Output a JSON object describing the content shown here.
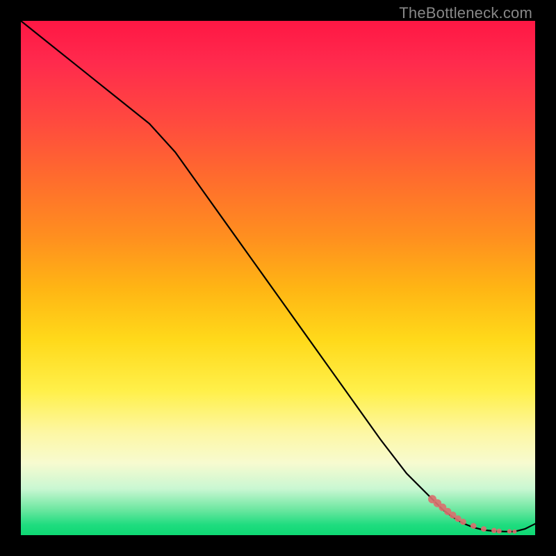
{
  "watermark": "TheBottleneck.com",
  "chart_data": {
    "type": "line",
    "title": "",
    "xlabel": "",
    "ylabel": "",
    "xlim": [
      0,
      100
    ],
    "ylim": [
      0,
      100
    ],
    "grid": false,
    "legend": false,
    "series": [
      {
        "name": "curve",
        "color": "#000000",
        "x": [
          0,
          5,
          10,
          15,
          20,
          25,
          30,
          35,
          40,
          45,
          50,
          55,
          60,
          65,
          70,
          75,
          80,
          82,
          84,
          86,
          88,
          90,
          92,
          94,
          96,
          98,
          100
        ],
        "y": [
          100,
          96,
          92,
          88,
          84,
          80,
          74.5,
          67.5,
          60.5,
          53.5,
          46.5,
          39.5,
          32.5,
          25.5,
          18.5,
          12,
          7,
          5,
          3.5,
          2.3,
          1.5,
          1,
          0.8,
          0.7,
          0.7,
          1.2,
          2.2
        ]
      }
    ],
    "markers": {
      "name": "highlight-points",
      "color": "#d9716f",
      "radius_min": 3,
      "radius_max": 6,
      "x": [
        80,
        81,
        82,
        83,
        84,
        85,
        86,
        88,
        90,
        92,
        93,
        95,
        96
      ],
      "y": [
        7,
        6.2,
        5.4,
        4.6,
        3.9,
        3.2,
        2.6,
        1.8,
        1.2,
        0.9,
        0.8,
        0.75,
        0.7
      ]
    }
  }
}
